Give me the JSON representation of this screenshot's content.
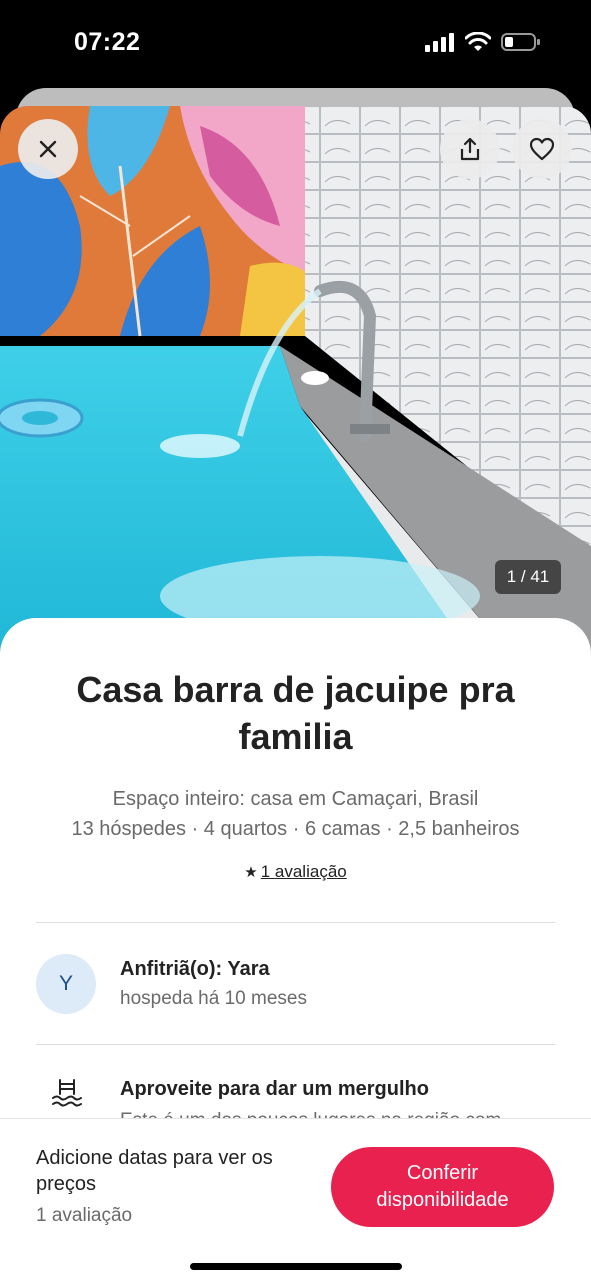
{
  "status_bar": {
    "time": "07:22"
  },
  "photo": {
    "counter": "1 / 41"
  },
  "listing": {
    "title": "Casa barra de jacuipe pra familia",
    "subtitle_line1": "Espaço inteiro: casa em Camaçari, Brasil",
    "subtitle_line2": "13 hóspedes · 4 quartos · 6 camas · 2,5 banheiros",
    "rating_star": "★",
    "rating_link": "1 avaliação"
  },
  "host": {
    "initial": "Y",
    "name": "Anfitriã(o): Yara",
    "since": "hospeda há 10 meses"
  },
  "feature": {
    "title": "Aproveite para dar um mergulho",
    "description": "Este é um dos poucos lugares na região com"
  },
  "booking": {
    "price_prompt": "Adicione datas para ver os preços",
    "reviews": "1 avaliação",
    "cta_label": "Conferir disponibilidade"
  },
  "colors": {
    "accent": "#e8214f",
    "avatar_bg": "#ddeaf8",
    "text_primary": "#222222",
    "text_secondary": "#6a6a6a"
  },
  "icons": {
    "close": "close-icon",
    "share": "share-icon",
    "favorite": "heart-icon",
    "pool": "pool-icon",
    "star": "star-icon"
  }
}
